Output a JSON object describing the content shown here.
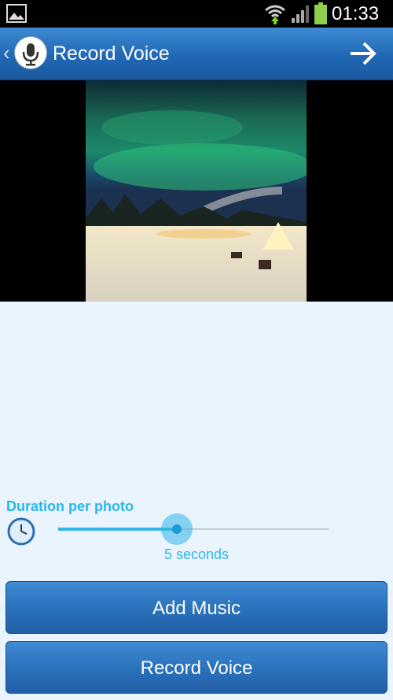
{
  "status_bar": {
    "time": "01:33",
    "icons": [
      "gallery-icon",
      "wifi-icon",
      "signal-icon",
      "battery-icon"
    ]
  },
  "action_bar": {
    "title": "Record Voice",
    "back_glyph": "‹",
    "icons": [
      "microphone-icon",
      "arrow-right-icon"
    ]
  },
  "photo": {
    "subject": "aurora-night-scene"
  },
  "duration": {
    "label": "Duration per photo",
    "value_text": "5 seconds",
    "slider_fraction": 0.44,
    "icon": "clock-icon"
  },
  "buttons": {
    "add_music": "Add Music",
    "record_voice": "Record Voice"
  },
  "colors": {
    "accent": "#33b5e5",
    "action_bar": "#2168b4",
    "background": "#eaf4ff"
  }
}
